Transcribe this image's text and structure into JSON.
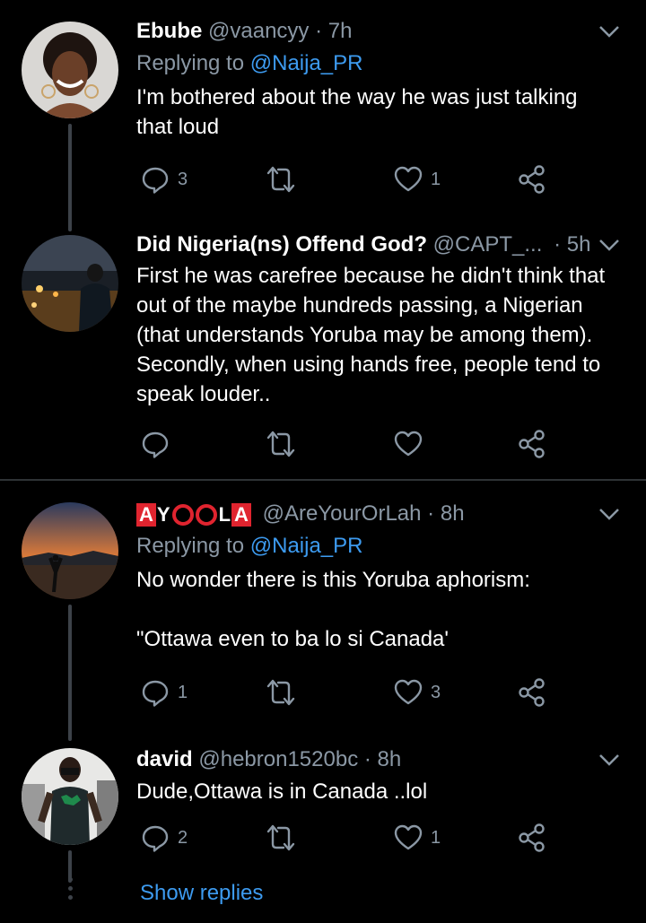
{
  "tweets": [
    {
      "name": "Ebube",
      "handle": "@vaancyy",
      "time": "7h",
      "replying_prefix": "Replying to",
      "replying_to": "@Naija_PR",
      "text": "I'm bothered about the way he was just talking that loud",
      "replies": "3",
      "retweets": "",
      "likes": "1"
    },
    {
      "name": "Did Nigeria(ns) Offend God?",
      "handle": "@CAPT_...",
      "time": "5h",
      "text": "First he was carefree because he didn't think that out of the maybe hundreds passing, a Nigerian (that understands Yoruba may be among them). Secondly, when using hands free, people tend to speak louder..",
      "replies": "",
      "retweets": "",
      "likes": ""
    },
    {
      "name_letters": [
        "A",
        "Y",
        "",
        "",
        "L",
        "A"
      ],
      "name": "AYOOLA",
      "handle": "@AreYourOrLah",
      "time": "8h",
      "replying_prefix": "Replying to",
      "replying_to": "@Naija_PR",
      "text": "No wonder there is this Yoruba aphorism:\n\n\"Ottawa even to ba lo si Canada'",
      "replies": "1",
      "retweets": "",
      "likes": "3"
    },
    {
      "name": "david",
      "handle": "@hebron1520bc",
      "time": "8h",
      "text": "Dude,Ottawa is in Canada ..lol",
      "replies": "2",
      "retweets": "",
      "likes": "1"
    }
  ],
  "dot_separator": "·",
  "show_replies": "Show replies",
  "icons": [
    "reply-icon",
    "retweet-icon",
    "like-icon",
    "share-icon",
    "chevron-down-icon"
  ],
  "colors": {
    "background": "#000000",
    "secondary_text": "#8b98a5",
    "link": "#3d9bf0",
    "divider": "#2f3336",
    "brand_red": "#e0242f"
  }
}
